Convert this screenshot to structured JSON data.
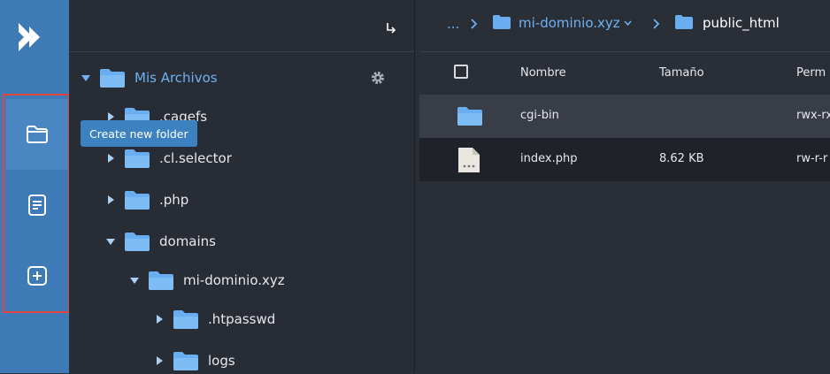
{
  "rail": {
    "logo_icon": "app-logo-icon",
    "buttons": [
      {
        "icon": "folder-outline-icon",
        "name": "new-folder"
      },
      {
        "icon": "document-icon",
        "name": "new-file"
      },
      {
        "icon": "plus-square-icon",
        "name": "upload-add"
      }
    ]
  },
  "tooltip": "Create new folder",
  "tree": {
    "root_label": "Mis Archivos",
    "items": [
      {
        "label": ".cagefs"
      },
      {
        "label": ".cl.selector"
      },
      {
        "label": ".php"
      },
      {
        "label": "domains"
      },
      {
        "label": "mi-dominio.xyz"
      },
      {
        "label": ".htpasswd"
      },
      {
        "label": "logs"
      }
    ]
  },
  "breadcrumb": {
    "ellipsis": "...",
    "items": [
      "mi-dominio.xyz",
      "public_html"
    ]
  },
  "table": {
    "columns": [
      "Nombre",
      "Tamaño",
      "Perm"
    ],
    "rows": [
      {
        "name": "cgi-bin",
        "size": "",
        "perm": "rwx-rx"
      },
      {
        "name": "index.php",
        "size": "8.62 KB",
        "perm": "rw-r-r"
      }
    ]
  },
  "colors": {
    "rail": "#3d7ab6",
    "accent": "#6eb2f2",
    "highlight_box": "#e0463e",
    "folder": "#69aef0"
  }
}
